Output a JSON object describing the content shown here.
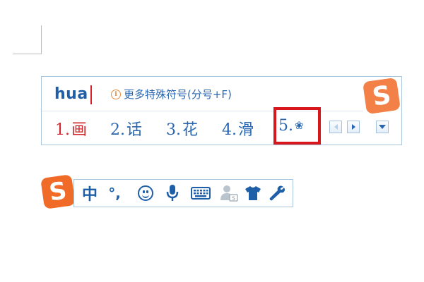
{
  "composition": {
    "pinyin": "hua",
    "hint_icon": "info-icon",
    "hint_text": "更多特殊符号(分号+F)"
  },
  "candidates": [
    {
      "num": "1.",
      "text": "画",
      "selected": true
    },
    {
      "num": "2.",
      "text": "话",
      "selected": false
    },
    {
      "num": "3.",
      "text": "花",
      "selected": false
    },
    {
      "num": "4.",
      "text": "滑",
      "selected": false
    },
    {
      "num": "5.",
      "text": "❀",
      "selected": false
    }
  ],
  "logo": {
    "letter": "S",
    "icon": "sogou-logo-icon"
  },
  "toolbar": {
    "language": "中",
    "punctuation": "°,",
    "icons": [
      "smiley-icon",
      "microphone-icon",
      "keyboard-icon",
      "user-icon",
      "tshirt-icon",
      "wrench-icon"
    ]
  },
  "colors": {
    "accent": "#1f5fa8",
    "candidate_blue": "#2b67b0",
    "selected_red": "#d0282c",
    "highlight_red": "#d9161c",
    "logo_orange": "#f06a28",
    "border": "#a9c6de"
  }
}
